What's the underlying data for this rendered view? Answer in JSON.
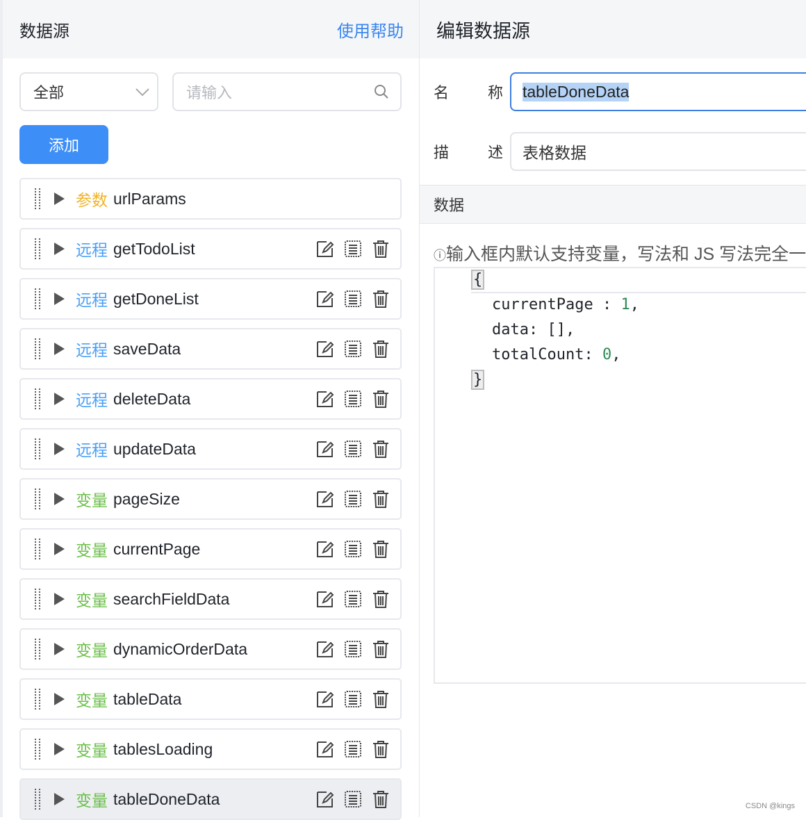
{
  "left": {
    "title": "数据源",
    "help": "使用帮助",
    "filter": "全部",
    "search_placeholder": "请输入",
    "add": "添加",
    "items": [
      {
        "tag": "参数",
        "name": "urlParams",
        "type": "param"
      },
      {
        "tag": "远程",
        "name": "getTodoList",
        "type": "remote"
      },
      {
        "tag": "远程",
        "name": "getDoneList",
        "type": "remote"
      },
      {
        "tag": "远程",
        "name": "saveData",
        "type": "remote"
      },
      {
        "tag": "远程",
        "name": "deleteData",
        "type": "remote"
      },
      {
        "tag": "远程",
        "name": "updateData",
        "type": "remote"
      },
      {
        "tag": "变量",
        "name": "pageSize",
        "type": "var"
      },
      {
        "tag": "变量",
        "name": "currentPage",
        "type": "var"
      },
      {
        "tag": "变量",
        "name": "searchFieldData",
        "type": "var"
      },
      {
        "tag": "变量",
        "name": "dynamicOrderData",
        "type": "var"
      },
      {
        "tag": "变量",
        "name": "tableData",
        "type": "var"
      },
      {
        "tag": "变量",
        "name": "tablesLoading",
        "type": "var"
      },
      {
        "tag": "变量",
        "name": "tableDoneData",
        "type": "var"
      }
    ]
  },
  "colors": {
    "param": "#f0b429",
    "remote": "#4a9ff5",
    "var": "#6cbf4a"
  },
  "right": {
    "title": "编辑数据源",
    "name_label": [
      "名",
      "称"
    ],
    "name_value": "tableDoneData",
    "desc_label": [
      "描",
      "述"
    ],
    "desc_value": "表格数据",
    "section": "数据",
    "hint": "输入框内默认支持变量，写法和 JS 写法完全一致",
    "code": {
      "open": "{",
      "l1_key": "currentPage : ",
      "l1_val": "1",
      "l2": "data: [],",
      "l3_key": "totalCount: ",
      "l3_val": "0",
      "close": "}"
    }
  },
  "watermark": "CSDN @kings"
}
